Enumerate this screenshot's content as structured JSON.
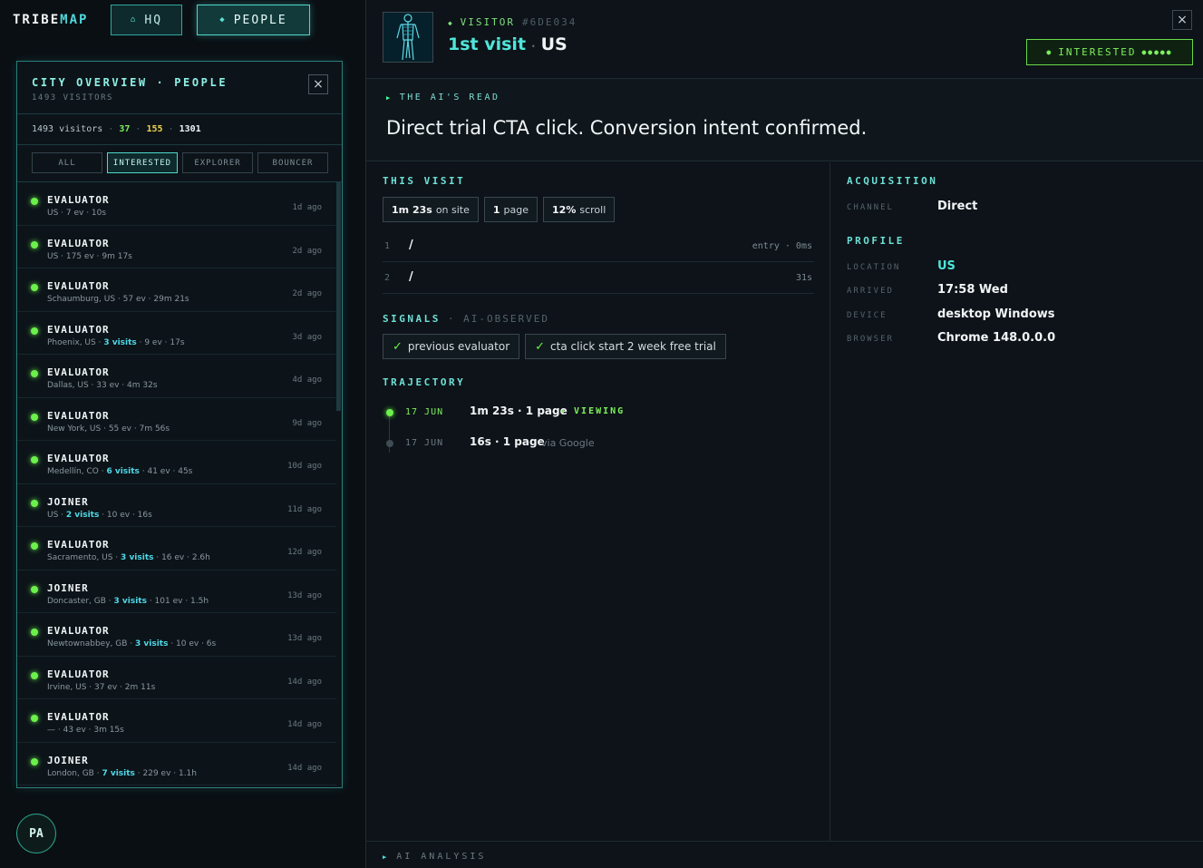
{
  "app": {
    "logo_a": "TRIBE",
    "logo_b": "MAP"
  },
  "nav": {
    "hq_label": "HQ",
    "people_label": "PEOPLE",
    "hq_icon": "home-icon",
    "people_icon": "diamond-icon"
  },
  "panel": {
    "title": "CITY OVERVIEW · PEOPLE",
    "subtitle": "1493 VISITORS",
    "close": "×",
    "stats": {
      "total": "1493 visitors",
      "a": "37",
      "b": "155",
      "c": "1301"
    },
    "filters": [
      {
        "label": "ALL",
        "active": false
      },
      {
        "label": "INTERESTED",
        "active": true
      },
      {
        "label": "EXPLORER",
        "active": false
      },
      {
        "label": "BOUNCER",
        "active": false
      }
    ],
    "rows": [
      {
        "type": "EVALUATOR",
        "loc": "US · ",
        "visits": "",
        "rest": "7 ev · 10s",
        "ago": "1d ago"
      },
      {
        "type": "EVALUATOR",
        "loc": "US · ",
        "visits": "",
        "rest": "175 ev · 9m 17s",
        "ago": "2d ago"
      },
      {
        "type": "EVALUATOR",
        "loc": "Schaumburg, US · ",
        "visits": "",
        "rest": "57 ev · 29m 21s",
        "ago": "2d ago"
      },
      {
        "type": "EVALUATOR",
        "loc": "Phoenix, US · ",
        "visits": "3 visits",
        "rest": " · 9 ev · 17s",
        "ago": "3d ago"
      },
      {
        "type": "EVALUATOR",
        "loc": "Dallas, US · ",
        "visits": "",
        "rest": "33 ev · 4m 32s",
        "ago": "4d ago"
      },
      {
        "type": "EVALUATOR",
        "loc": "New York, US · ",
        "visits": "",
        "rest": "55 ev · 7m 56s",
        "ago": "9d ago"
      },
      {
        "type": "EVALUATOR",
        "loc": "Medellín, CO · ",
        "visits": "6 visits",
        "rest": " · 41 ev · 45s",
        "ago": "10d ago"
      },
      {
        "type": "JOINER",
        "loc": "US · ",
        "visits": "2 visits",
        "rest": " · 10 ev · 16s",
        "ago": "11d ago"
      },
      {
        "type": "EVALUATOR",
        "loc": "Sacramento, US · ",
        "visits": "3 visits",
        "rest": " · 16 ev · 2.6h",
        "ago": "12d ago"
      },
      {
        "type": "JOINER",
        "loc": "Doncaster, GB · ",
        "visits": "3 visits",
        "rest": " · 101 ev · 1.5h",
        "ago": "13d ago"
      },
      {
        "type": "EVALUATOR",
        "loc": "Newtownabbey, GB · ",
        "visits": "3 visits",
        "rest": " · 10 ev · 6s",
        "ago": "13d ago"
      },
      {
        "type": "EVALUATOR",
        "loc": "Irvine, US · ",
        "visits": "",
        "rest": "37 ev · 2m 11s",
        "ago": "14d ago"
      },
      {
        "type": "EVALUATOR",
        "loc": "— · ",
        "visits": "",
        "rest": "43 ev · 3m 15s",
        "ago": "14d ago"
      },
      {
        "type": "JOINER",
        "loc": "London, GB · ",
        "visits": "7 visits",
        "rest": " · 229 ev · 1.1h",
        "ago": "14d ago"
      }
    ]
  },
  "user": {
    "initials": "PA"
  },
  "visitor": {
    "label": "VISITOR",
    "id": "#6DE034",
    "visit": "1st visit",
    "country": "US",
    "close": "×",
    "status": "INTERESTED",
    "status_pips": "●●●●●",
    "colors": {
      "accent": "#4fe6da",
      "status": "#7cf05c"
    }
  },
  "ai_read": {
    "label": "THE AI'S READ",
    "text": "Direct trial CTA click. Conversion intent confirmed."
  },
  "this_visit": {
    "label": "THIS VISIT",
    "chips": [
      {
        "bold": "1m 23s",
        "rest": "on site"
      },
      {
        "bold": "1",
        "rest": "page"
      },
      {
        "bold": "12%",
        "rest": "scroll"
      }
    ],
    "pages": [
      {
        "n": "1",
        "path": "/",
        "time": "entry · 0ms"
      },
      {
        "n": "2",
        "path": "/",
        "time": "31s"
      }
    ]
  },
  "signals": {
    "label": "SIGNALS",
    "sub": "· AI-OBSERVED",
    "items": [
      "previous evaluator",
      "cta click start 2 week free trial"
    ]
  },
  "trajectory": {
    "label": "TRAJECTORY",
    "items": [
      {
        "date": "17 JUN",
        "info": "1m 23s · 1 page",
        "extra": "◂ VIEWING",
        "via": ""
      },
      {
        "date": "17 JUN",
        "info": "16s · 1 page",
        "extra": "",
        "via": "via Google"
      }
    ]
  },
  "acquisition": {
    "label": "ACQUISITION",
    "channel_k": "CHANNEL",
    "channel_v": "Direct"
  },
  "profile": {
    "label": "PROFILE",
    "items": [
      {
        "k": "LOCATION",
        "v": "US"
      },
      {
        "k": "ARRIVED",
        "v": "17:58 Wed"
      },
      {
        "k": "DEVICE",
        "v": "desktop Windows"
      },
      {
        "k": "BROWSER",
        "v": "Chrome 148.0.0.0"
      }
    ]
  },
  "footer": {
    "label": "AI ANALYSIS"
  }
}
